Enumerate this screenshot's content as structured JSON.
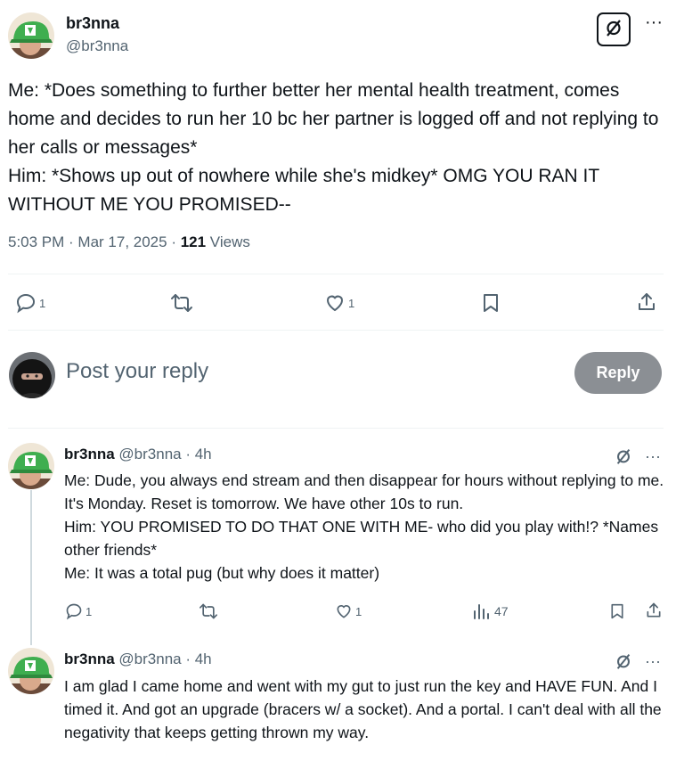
{
  "post": {
    "author_name": "br3nna",
    "author_handle": "@br3nna",
    "body": "Me: *Does something to further better her mental health treatment, comes home and decides to run her 10 bc her partner is logged off and not replying to her calls or messages*\nHim: *Shows up out of nowhere while she's midkey* OMG YOU RAN IT WITHOUT ME YOU PROMISED--",
    "time": "5:03 PM · Mar 17, 2025 · ",
    "views_count": "121",
    "views_label": " Views",
    "reply_count": "1",
    "like_count": "1"
  },
  "composer": {
    "placeholder": "Post your reply",
    "button_label": "Reply"
  },
  "replies": [
    {
      "author_name": "br3nna",
      "meta": "@br3nna · 4h",
      "body": "Me: Dude, you always end stream and then disappear for hours without replying to me. It's Monday. Reset is tomorrow. We have other 10s to run.\nHim: YOU PROMISED TO DO THAT ONE WITH ME- who did you play with!? *Names other friends*\nMe: It was a total pug (but why does it matter)",
      "reply_count": "1",
      "like_count": "1",
      "views_count": "47"
    },
    {
      "author_name": "br3nna",
      "meta": "@br3nna · 4h",
      "body": "I am glad I came home and went with my gut to just run the key and HAVE FUN. And I timed it. And got an upgrade (bracers w/ a socket). And a portal. I can't deal with all the negativity that keeps getting thrown my way."
    }
  ],
  "icons": {
    "reply": "speech-bubble-icon",
    "repost": "repost-arrows-icon",
    "like": "heart-icon",
    "bookmark": "bookmark-icon",
    "share": "share-upload-icon",
    "views": "bar-chart-icon",
    "grok": "grok-slash-circle-icon",
    "more": "ellipsis-icon"
  },
  "colors": {
    "text": "#0f1419",
    "secondary": "#536471",
    "divider": "#eff3f4",
    "reply_button_disabled": "#8b8f94",
    "avatar_cap": "#3fae4f"
  }
}
